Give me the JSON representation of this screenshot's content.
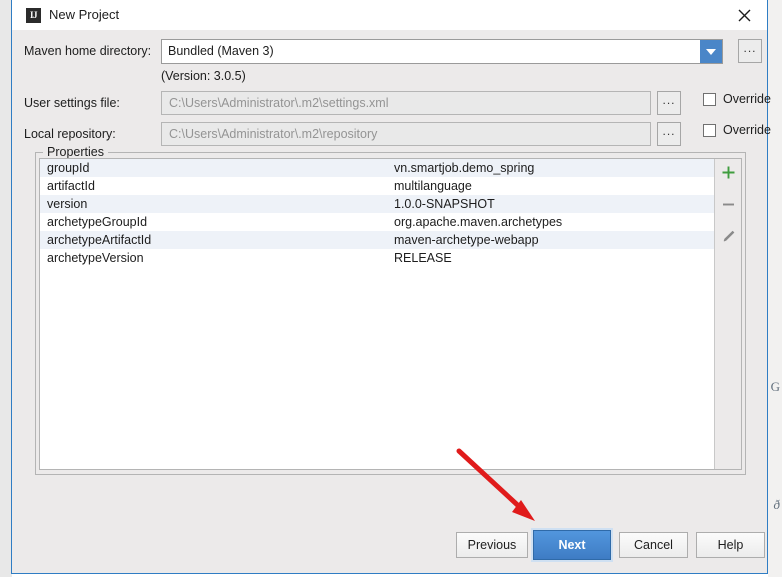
{
  "window": {
    "title": "New Project",
    "app_icon": "IJ",
    "close_icon": "close-icon"
  },
  "background": {
    "right_glyph_top": "G",
    "right_glyph_bottom": "ð"
  },
  "form": {
    "maven_home": {
      "label": "Maven home directory:",
      "value": "Bundled (Maven 3)",
      "dropdown_icon": "chevron-down-icon",
      "browse_label": "...",
      "version_note": "(Version: 3.0.5)"
    },
    "user_settings": {
      "label": "User settings file:",
      "value": "C:\\Users\\Administrator\\.m2\\settings.xml",
      "browse_label": "...",
      "override_label": "Override",
      "override_checked": false
    },
    "local_repository": {
      "label": "Local repository:",
      "value": "C:\\Users\\Administrator\\.m2\\repository",
      "browse_label": "...",
      "override_label": "Override",
      "override_checked": false
    }
  },
  "properties": {
    "group_title": "Properties",
    "rows": [
      {
        "key": "groupId",
        "value": "vn.smartjob.demo_spring"
      },
      {
        "key": "artifactId",
        "value": "multilanguage"
      },
      {
        "key": "version",
        "value": "1.0.0-SNAPSHOT"
      },
      {
        "key": "archetypeGroupId",
        "value": "org.apache.maven.archetypes"
      },
      {
        "key": "archetypeArtifactId",
        "value": "maven-archetype-webapp"
      },
      {
        "key": "archetypeVersion",
        "value": "RELEASE"
      }
    ],
    "toolbar": {
      "add_icon": "plus-icon",
      "remove_icon": "minus-icon",
      "edit_icon": "pencil-icon",
      "add_color": "#3f9d3f",
      "remove_color": "#8a8a8a",
      "edit_color": "#8a8a8a"
    }
  },
  "footer": {
    "previous_label": "Previous",
    "next_label": "Next",
    "cancel_label": "Cancel",
    "help_label": "Help",
    "next_accent_color": "#3e7cc4"
  },
  "annotation": {
    "arrow_color": "#e01b1b",
    "arrow_name": "red-pointer-arrow"
  }
}
